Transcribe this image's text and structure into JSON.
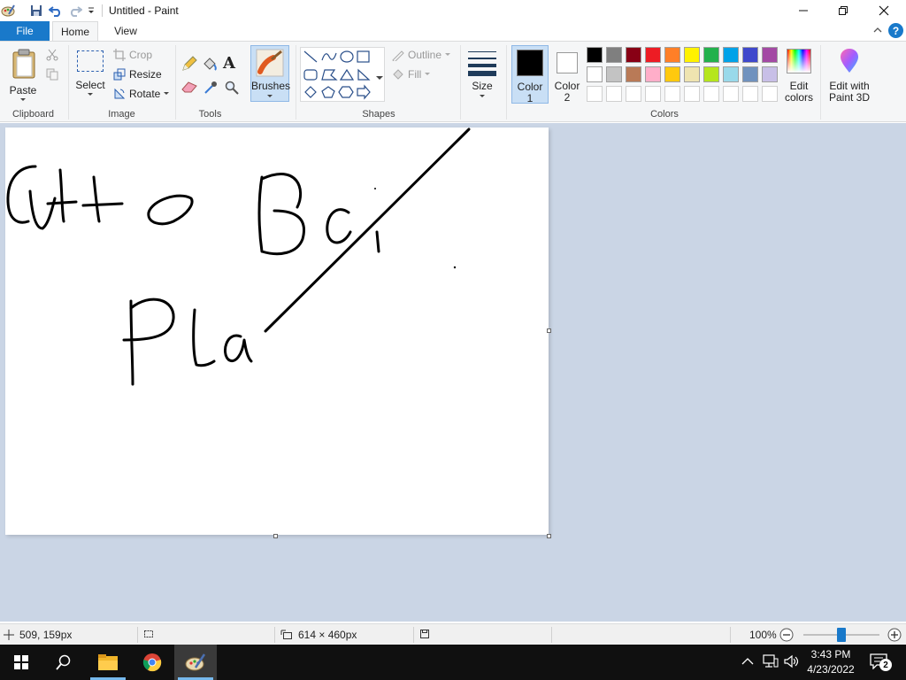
{
  "window": {
    "title": "Untitled - Paint"
  },
  "tabs": {
    "file": "File",
    "home": "Home",
    "view": "View"
  },
  "clipboard": {
    "paste": "Paste",
    "group": "Clipboard"
  },
  "image": {
    "select": "Select",
    "crop": "Crop",
    "resize": "Resize",
    "rotate": "Rotate",
    "group": "Image"
  },
  "tools": {
    "group": "Tools"
  },
  "brushes": {
    "label": "Brushes"
  },
  "shapes": {
    "outline": "Outline",
    "fill": "Fill",
    "group": "Shapes"
  },
  "size": {
    "label": "Size"
  },
  "colors": {
    "color1_line1": "Color",
    "color1_line2": "1",
    "color2_line1": "Color",
    "color2_line2": "2",
    "edit_line1": "Edit",
    "edit_line2": "colors",
    "paint3d_line1": "Edit with",
    "paint3d_line2": "Paint 3D",
    "group": "Colors",
    "palette_row1": [
      "#000000",
      "#7f7f7f",
      "#880015",
      "#ed1c24",
      "#ff7f27",
      "#fff200",
      "#22b14c",
      "#00a2e8",
      "#3f48cc",
      "#a349a4"
    ],
    "palette_row2": [
      "#ffffff",
      "#c3c3c3",
      "#b97a57",
      "#ffaec9",
      "#ffc90e",
      "#efe4b0",
      "#b5e61d",
      "#99d9ea",
      "#7092be",
      "#c8bfe7"
    ]
  },
  "status": {
    "cursor_pos": "509, 159px",
    "canvas_size": "614 × 460px",
    "zoom": "100%"
  },
  "taskbar": {
    "time": "3:43 PM",
    "date": "4/23/2022",
    "notifications": "2"
  }
}
